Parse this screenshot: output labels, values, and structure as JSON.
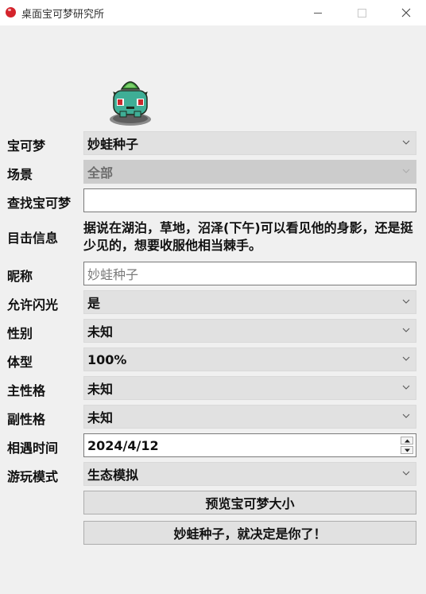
{
  "window": {
    "title": "桌面宝可梦研究所",
    "icon": "pokeball-icon"
  },
  "sprite": {
    "name": "bulbasaur-sprite-icon"
  },
  "form": {
    "pokemon": {
      "label": "宝可梦",
      "value": "妙蛙种子"
    },
    "scene": {
      "label": "场景",
      "value": "全部"
    },
    "search": {
      "label": "查找宝可梦",
      "value": ""
    },
    "sighting": {
      "label": "目击信息",
      "text": "据说在湖泊，草地，沼泽(下午)可以看见他的身影，还是挺少见的，想要收服他相当棘手。"
    },
    "nickname": {
      "label": "昵称",
      "value": "妙蛙种子"
    },
    "shiny": {
      "label": "允许闪光",
      "value": "是"
    },
    "gender": {
      "label": "性别",
      "value": "未知"
    },
    "size": {
      "label": "体型",
      "value": "100%"
    },
    "main_nature": {
      "label": "主性格",
      "value": "未知"
    },
    "sub_nature": {
      "label": "副性格",
      "value": "未知"
    },
    "encounter_time": {
      "label": "相遇时间",
      "value": "2024/4/12"
    },
    "play_mode": {
      "label": "游玩模式",
      "value": "生态模拟"
    }
  },
  "buttons": {
    "preview": "预览宝可梦大小",
    "choose": "妙蛙种子，就决定是你了！"
  }
}
